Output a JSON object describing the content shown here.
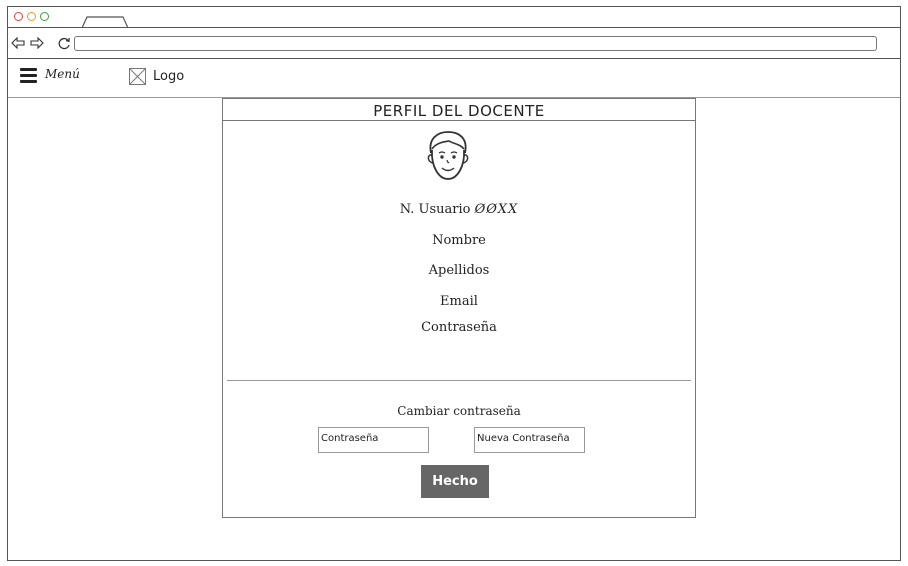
{
  "header": {
    "menu_label": "Menú",
    "logo_label": "Logo"
  },
  "icons": {
    "menu": "hamburger-icon",
    "logo": "image-placeholder-icon",
    "back": "back-arrow-icon",
    "forward": "forward-arrow-icon",
    "reload": "reload-icon",
    "avatar": "user-avatar-icon"
  },
  "profile": {
    "title": "PERFIL DEL DOCENTE",
    "user_number_label": "N. Usuario",
    "user_number_value": "ØØXX",
    "name_label": "Nombre",
    "surname_label": "Apellidos",
    "email_label": "Email",
    "password_label": "Contraseña"
  },
  "change_password": {
    "title": "Cambiar contraseña",
    "current_placeholder": "Contraseña",
    "new_placeholder": "Nueva Contraseña",
    "submit_label": "Hecho"
  },
  "colors": {
    "button_bg": "#666666",
    "close_dot": "#d9453b",
    "minimize_dot": "#e89b2c",
    "maximize_dot": "#3da048"
  }
}
